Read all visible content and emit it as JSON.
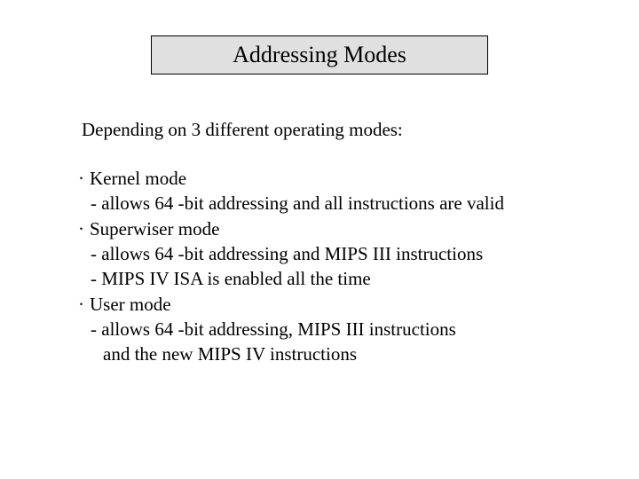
{
  "title": "Addressing Modes",
  "intro": "Depending on 3 different operating modes:",
  "modes": [
    {
      "name": "Kernel mode",
      "details": [
        "- allows 64 -bit addressing and all instructions are valid"
      ]
    },
    {
      "name": "Superwiser mode",
      "details": [
        "- allows 64 -bit addressing and MIPS III instructions",
        "- MIPS IV ISA is enabled all the time"
      ]
    },
    {
      "name": "User mode",
      "details": [
        "- allows 64 -bit addressing, MIPS III instructions",
        "  and the new MIPS IV instructions"
      ]
    }
  ],
  "bullet": "·"
}
